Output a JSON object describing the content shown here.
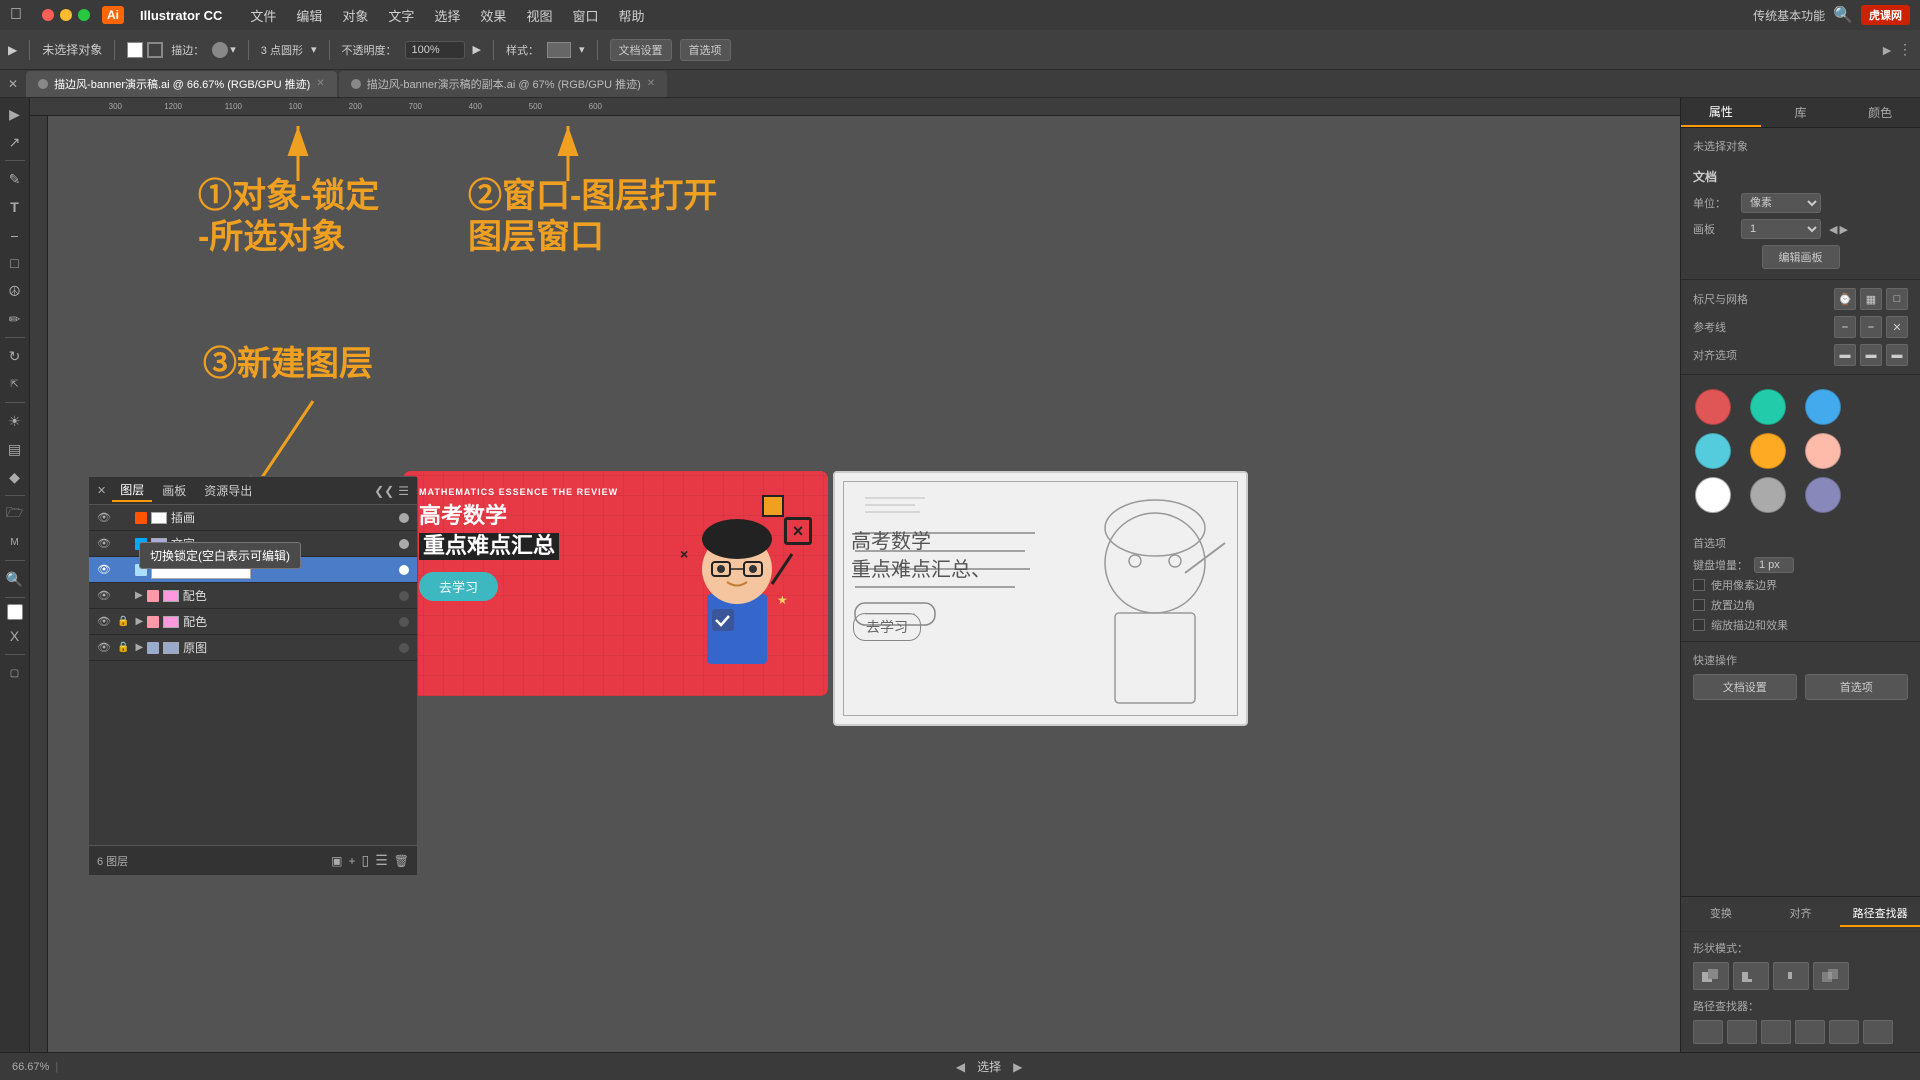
{
  "app": {
    "name": "Illustrator CC",
    "ai_logo": "Ai",
    "logo_bg": "#ff6600"
  },
  "menu": {
    "items": [
      "文件",
      "编辑",
      "对象",
      "文字",
      "选择",
      "效果",
      "视图",
      "窗口",
      "帮助"
    ]
  },
  "toolbar": {
    "no_selection": "未选择对象",
    "stroke_label": "描边：",
    "three_pt_circle": "3 点圆形",
    "opacity_label": "不透明度：",
    "opacity_value": "100%",
    "style_label": "样式：",
    "doc_settings": "文档设置",
    "preferences": "首选项"
  },
  "tabs": [
    {
      "label": "描边风-banner演示稿.ai",
      "zoom": "66.67%",
      "mode": "RGB/GPU 推迹",
      "active": true
    },
    {
      "label": "描边风-banner演示稿的副本.ai",
      "zoom": "67%",
      "mode": "RGB/GPU 推迹",
      "active": false
    }
  ],
  "annotations": {
    "text1": "①对象-锁定\n-所选对象",
    "text1_line1": "①对象-锁定",
    "text1_line2": "-所选对象",
    "text2": "②窗口-图层打开\n图层窗口",
    "text2_line1": "②窗口-图层打开",
    "text2_line2": "图层窗口",
    "text3": "③新建图层",
    "color": "#f0a020"
  },
  "layers_panel": {
    "tabs": [
      "图层",
      "画板",
      "资源导出"
    ],
    "layers": [
      {
        "name": "插画",
        "color": "#ff5500",
        "visible": true,
        "locked": false,
        "has_eye": true
      },
      {
        "name": "文字",
        "color": "#00aaff",
        "visible": true,
        "locked": false,
        "has_eye": true
      },
      {
        "name": "",
        "color": "#aaddff",
        "visible": true,
        "locked": false,
        "has_eye": true,
        "active": true
      },
      {
        "name": "配色",
        "color": "#ff99aa",
        "visible": true,
        "locked": false,
        "has_sublayer": true
      },
      {
        "name": "配色",
        "color": "#ff99aa",
        "visible": true,
        "locked": true,
        "has_sublayer": true
      },
      {
        "name": "原图",
        "color": "#99aacc",
        "visible": true,
        "locked": true,
        "has_sublayer": true
      }
    ],
    "footer": "6 图层",
    "tooltip": "切换锁定(空白表示可编辑)"
  },
  "right_panel": {
    "tabs": [
      "属性",
      "库",
      "颜色"
    ],
    "active_tab": "属性",
    "no_selection": "未选择对象",
    "doc_section": "文档",
    "unit_label": "单位：",
    "unit_value": "像素",
    "artboard_label": "画板",
    "artboard_value": "1",
    "edit_artboard_btn": "编辑画板",
    "align_section": "标尺与网格",
    "guides_section": "参考线",
    "align_to_section": "对齐选项",
    "preference_section": "首选项",
    "keyboard_increment_label": "键盘增量：",
    "keyboard_increment_value": "1 px",
    "snap_to_pixel_label": "使用像素边界",
    "corner_radius_label": "放置边角",
    "snap_raster_label": "缩放描边和效果",
    "quick_actions": "快速操作",
    "doc_settings_btn": "文档设置",
    "preferences_btn": "首选项",
    "bottom_tabs": [
      "变换",
      "对齐",
      "路径查找器"
    ],
    "active_bottom_tab": "路径查找器",
    "shape_modes_label": "形状模式：",
    "path_finder_label": "路径查找器：",
    "swatches": [
      {
        "color": "#e05555",
        "label": "red"
      },
      {
        "color": "#22ccaa",
        "label": "teal"
      },
      {
        "color": "#44aaee",
        "label": "blue"
      },
      {
        "color": "#55ccdd",
        "label": "cyan"
      },
      {
        "color": "#ffaa22",
        "label": "orange"
      },
      {
        "color": "#ffbbaa",
        "label": "peach"
      },
      {
        "color": "#ffffff",
        "label": "white"
      },
      {
        "color": "#aaaaaa",
        "label": "gray"
      },
      {
        "color": "#8888bb",
        "label": "purple"
      }
    ]
  },
  "status_bar": {
    "zoom": "66.67%",
    "mode_label": "选择"
  },
  "banner": {
    "tag": "MATHEMATICS ESSENCE THE REVIEW",
    "title_line1": "高考数学",
    "title_line2": "重点难点汇总",
    "button_text": "去学习"
  },
  "sketch": {
    "title_line1": "高考数学",
    "title_line2": "重点难点汇总",
    "button_text": "去学习"
  },
  "top_right": {
    "function_label": "传统基本功能",
    "logo_text": "虎课网"
  }
}
